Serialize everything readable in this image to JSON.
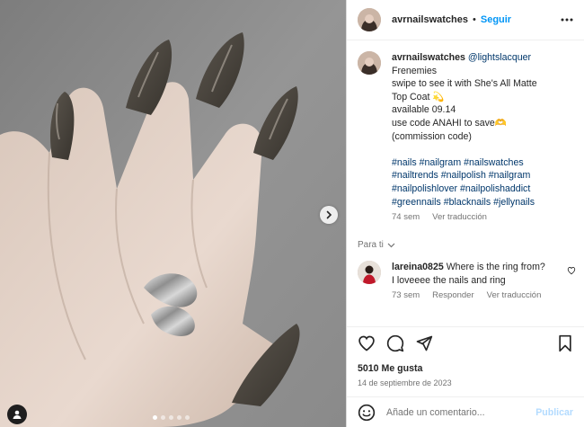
{
  "post": {
    "username": "avrnailswatches",
    "separator": "•",
    "follow_label": "Seguir",
    "more_icon": "more-horizontal-icon",
    "carousel": {
      "total_slides": 5,
      "active_index": 0,
      "next_icon": "chevron-right-icon",
      "tag_icon": "user-tag-icon"
    }
  },
  "caption": {
    "username": "avrnailswatches",
    "mention": "@lightslacquer",
    "lines": [
      "Frenemies",
      "swipe to see it with She's All Matte",
      "Top Coat 💫",
      "available 09.14",
      "use code ANAHI to save🫶",
      "(commission code)"
    ],
    "hashtag_lines": [
      "#nails #nailgram #nailswatches",
      "#nailtrends #nailpolish #nailgram",
      "#nailpolishlover #nailpolishaddict",
      "#greennails #blacknails #jellynails"
    ],
    "time": "74 sem",
    "translate_label": "Ver traducción"
  },
  "translated_for": "Para ti",
  "comment": {
    "username": "lareina0825",
    "text_first": "Where is the ring from?",
    "text_second": "I loveeee the nails and ring",
    "time": "73 sem",
    "reply_label": "Responder",
    "translate_label": "Ver traducción"
  },
  "actions": {
    "like_icon": "heart-icon",
    "comment_icon": "comment-icon",
    "share_icon": "share-icon",
    "save_icon": "bookmark-icon"
  },
  "likes": "5010 Me gusta",
  "date": "14 de septiembre de 2023",
  "add_comment": {
    "emoji_icon": "emoji-icon",
    "placeholder": "Añade un comentario...",
    "publish_label": "Publicar"
  },
  "colors": {
    "link_blue": "#0095f6",
    "publish_disabled": "#b3dbff",
    "secondary_text": "#737373",
    "hashtag": "#00376b",
    "nail_polish": "#4a453e"
  }
}
